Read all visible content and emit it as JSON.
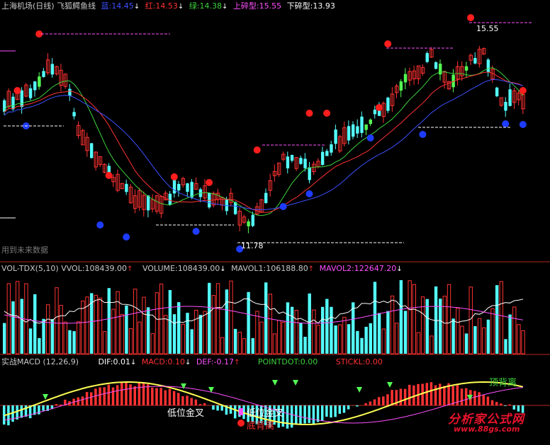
{
  "header": {
    "title": "上海机场(日线)",
    "indicator": "飞狐鳄鱼线",
    "blue_label": "蓝:",
    "blue_value": "14.45",
    "red_label": "红:",
    "red_value": "14.53",
    "green_label": "绿:",
    "green_value": "14.38",
    "upper_fractal_label": "上碎型:",
    "upper_fractal_value": "15.55",
    "lower_fractal_label": "下碎型:",
    "lower_fractal_value": "13.93"
  },
  "main_panel": {
    "high_marker": "15.55",
    "low_marker": "11.78",
    "future_data_note": "用到未来数据"
  },
  "volume_panel": {
    "name": "VOL-TDX(5,10)",
    "vvol_label": "VVOL:",
    "vvol_value": "108439.00",
    "volume_label": "VOLUME:",
    "volume_value": "108439.00",
    "mavol1_label": "MAVOL1:",
    "mavol1_value": "106188.80",
    "mavol2_label": "MAVOL2:",
    "mavol2_value": "122647.20"
  },
  "macd_panel": {
    "name": "实战MACD (12,26,9)",
    "dif_label": "DIF:",
    "dif_value": "0.01",
    "macd_label": "MACD:",
    "macd_value": "0.10",
    "def_label": "DEF:",
    "def_value": "-0.17",
    "pointdot_label": "POINTDOT:",
    "pointdot_value": "0.00",
    "stickl_label": "STICKL:",
    "stickl_value": "0.00",
    "annotations": {
      "low_golden_cross": "低位金叉",
      "low_golden_cross_2": "低位金叉",
      "bottom_divergence": "底背离",
      "top_divergence": "顶背离"
    }
  },
  "watermark": {
    "brand": "分析家公式网",
    "url": "www.88gs.com"
  },
  "colors": {
    "background": "#000000",
    "up": "#ff3232",
    "down": "#54fcfc",
    "green_candle": "#54ff54",
    "blue_line": "#3c50ff",
    "red_line": "#ff3232",
    "green_line": "#3cd23c",
    "magenta": "#ff50ff",
    "yellow": "#ffff54",
    "white": "#ffffff",
    "grid_border": "#b4281e"
  },
  "chart_data": {
    "type": "candlestick",
    "y_range": [
      11.5,
      15.8
    ],
    "high": 15.55,
    "low": 11.78,
    "last_close": 14.45,
    "series": [
      {
        "name": "蓝",
        "last_value": 14.45
      },
      {
        "name": "红",
        "last_value": 14.53
      },
      {
        "name": "绿",
        "last_value": 14.38
      }
    ]
  }
}
